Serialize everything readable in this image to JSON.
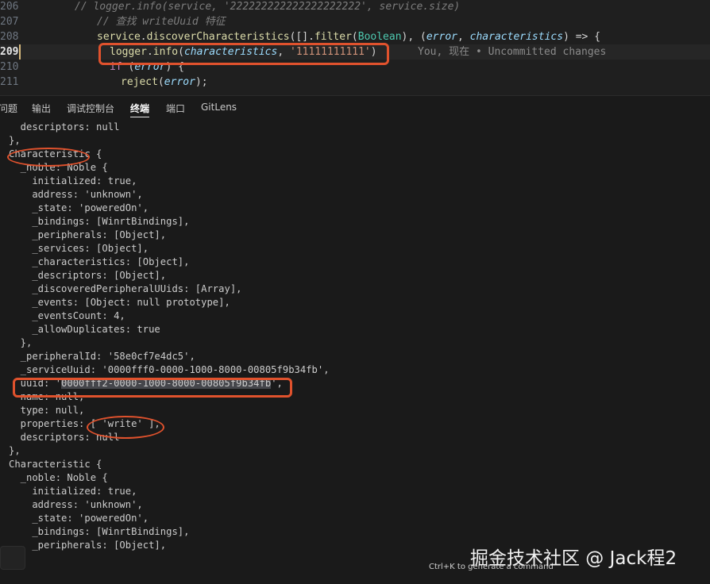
{
  "editor": {
    "lines": [
      {
        "num": "206",
        "tokens": [
          [
            "cmt",
            "// logger.info(service, '222222222222222222222', service.size)"
          ]
        ]
      },
      {
        "num": "207",
        "tokens": [
          [
            "cmt",
            "// 查找 writeUuid 特征"
          ]
        ]
      },
      {
        "num": "208",
        "tokens": [
          [
            "fn",
            "service"
          ],
          [
            "",
            "."
          ],
          [
            "fn",
            "discoverCharacteristics"
          ],
          [
            "",
            "([]."
          ],
          [
            "fn",
            "filter"
          ],
          [
            "",
            "("
          ],
          [
            "cls",
            "Boolean"
          ],
          [
            "",
            "), ("
          ],
          [
            "var",
            "error"
          ],
          [
            "",
            ", "
          ],
          [
            "var",
            "characteristics"
          ],
          [
            "",
            ") => {"
          ]
        ]
      },
      {
        "num": "209",
        "tokens": [
          [
            "fn",
            "logger"
          ],
          [
            "",
            "."
          ],
          [
            "fn",
            "info"
          ],
          [
            "",
            "("
          ],
          [
            "var",
            "characteristics"
          ],
          [
            "",
            ", "
          ],
          [
            "str",
            "'11111111111'"
          ],
          [
            "",
            ")"
          ]
        ]
      },
      {
        "num": "210",
        "tokens": [
          [
            "kw",
            "if"
          ],
          [
            "",
            " ("
          ],
          [
            "var",
            "error"
          ],
          [
            "",
            ") {"
          ]
        ]
      },
      {
        "num": "211",
        "tokens": [
          [
            "fn",
            "reject"
          ],
          [
            "",
            "("
          ],
          [
            "var",
            "error"
          ],
          [
            "",
            ");"
          ]
        ]
      }
    ],
    "blame": "You, 现在 • Uncommitted changes"
  },
  "panel": {
    "tabs": [
      "问题",
      "输出",
      "调试控制台",
      "终端",
      "端口",
      "GitLens"
    ],
    "active_tab": "终端"
  },
  "terminal": {
    "lines": [
      "  descriptors: null",
      "},",
      "Characteristic {",
      "  _noble: Noble {",
      "    initialized: true,",
      "    address: 'unknown',",
      "    _state: 'poweredOn',",
      "    _bindings: [WinrtBindings],",
      "    _peripherals: [Object],",
      "    _services: [Object],",
      "    _characteristics: [Object],",
      "    _descriptors: [Object],",
      "    _discoveredPeripheralUUids: [Array],",
      "    _events: [Object: null prototype],",
      "    _eventsCount: 4,",
      "    _allowDuplicates: true",
      "  },",
      "  _peripheralId: '58e0cf7e4dc5',",
      "  _serviceUuid: '0000fff0-0000-1000-8000-00805f9b34fb',",
      "  uuid: '0000fff2-0000-1000-8000-00805f9b34fb',",
      "  name: null,",
      "  type: null,",
      "  properties: [ 'write' ],",
      "  descriptors: null",
      "},",
      "Characteristic {",
      "  _noble: Noble {",
      "    initialized: true,",
      "    address: 'unknown',",
      "    _state: 'poweredOn',",
      "    _bindings: [WinrtBindings],",
      "    _peripherals: [Object],"
    ],
    "selected_text": "0000fff2-0000-1000-8000-00805f9b34fb"
  },
  "hint": "Ctrl+K to generate a command",
  "watermark": "掘金技术社区 @ Jack程2",
  "colors": {
    "annotation": "#e0522d",
    "selection": "#45464b",
    "git_modified": "#d7ba7d"
  }
}
